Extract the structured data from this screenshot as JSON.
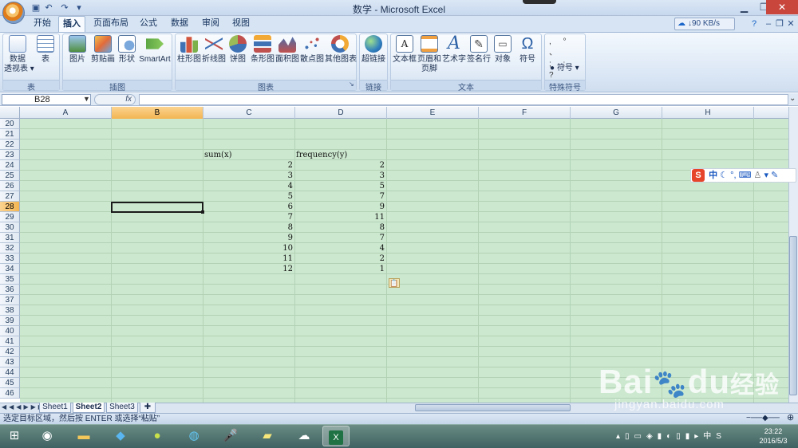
{
  "window": {
    "title": "数学 - Microsoft Excel"
  },
  "tabs": [
    "开始",
    "插入",
    "页面布局",
    "公式",
    "数据",
    "审阅",
    "视图"
  ],
  "active_tab": "插入",
  "network_speed": "↓90 KB/s",
  "ribbon": {
    "groups": [
      {
        "label": "表",
        "buttons": [
          "数据\n透视表 ▾",
          "表"
        ]
      },
      {
        "label": "插图",
        "buttons": [
          "图片",
          "剪贴画",
          "形状",
          "SmartArt"
        ]
      },
      {
        "label": "图表",
        "buttons": [
          "柱形图",
          "折线图",
          "饼图",
          "条形图",
          "面积图",
          "散点图",
          "其他图表"
        ]
      },
      {
        "label": "链接",
        "buttons": [
          "超链接"
        ]
      },
      {
        "label": "文本",
        "buttons": [
          "文本框",
          "页眉和\n页脚",
          "艺术字",
          "签名行",
          "对象",
          "符号"
        ]
      },
      {
        "label": "特殊符号",
        "buttons": [
          "符号 ▾"
        ]
      }
    ]
  },
  "formula_bar": {
    "name_box": "B28",
    "fx": "fx",
    "value": ""
  },
  "columns": [
    "A",
    "B",
    "C",
    "D",
    "E",
    "F",
    "G",
    "H"
  ],
  "selected_column": "B",
  "rows": [
    "20",
    "21",
    "22",
    "23",
    "24",
    "25",
    "26",
    "27",
    "28",
    "29",
    "30",
    "31",
    "32",
    "33",
    "34",
    "35",
    "36",
    "37",
    "38",
    "39",
    "40",
    "41",
    "42",
    "43",
    "44",
    "45",
    "46"
  ],
  "selected_row": "28",
  "table": {
    "header_x": "sum(x)",
    "header_y": "frequency(y)",
    "x": [
      "2",
      "3",
      "4",
      "5",
      "6",
      "7",
      "8",
      "9",
      "10",
      "11",
      "12"
    ],
    "y": [
      "2",
      "3",
      "5",
      "7",
      "9",
      "11",
      "8",
      "7",
      "4",
      "2",
      "1"
    ]
  },
  "sheets": [
    "Sheet1",
    "Sheet2",
    "Sheet3"
  ],
  "active_sheet": "Sheet2",
  "status": "选定目标区域，然后按 ENTER 或选择“粘贴”",
  "clock": {
    "time": "23:22",
    "date": "2016/5/3"
  },
  "ime": {
    "mode": "中"
  },
  "watermark": {
    "brand": "Bai",
    "brand2": "du",
    "suffix": "经验",
    "url": "jingyan.baidu.com"
  },
  "colors": {
    "grid_bg": "#cce8cf",
    "selection_header": "#f3b553",
    "excel_green": "#1f7244"
  }
}
